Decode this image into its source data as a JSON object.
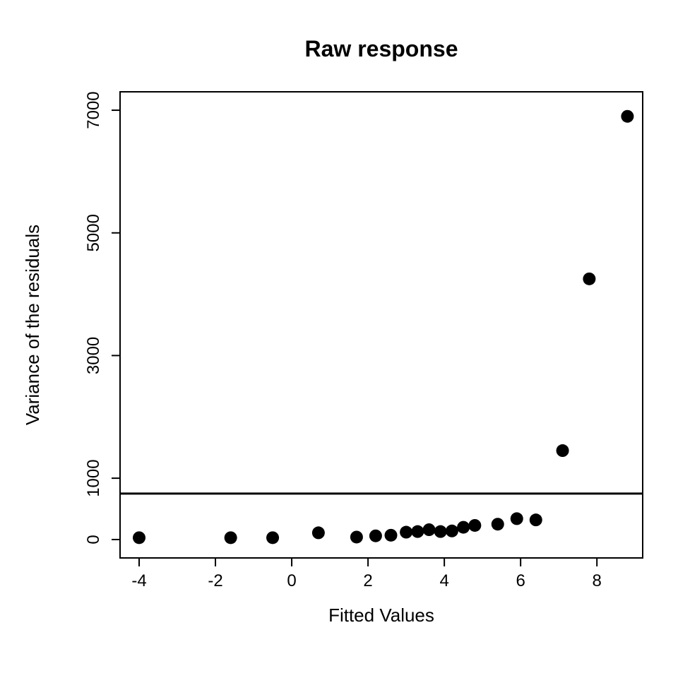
{
  "chart_data": {
    "type": "scatter",
    "title": "Raw response",
    "xlabel": "Fitted Values",
    "ylabel": "Variance of the residuals",
    "xlim": [
      -4.5,
      9.2
    ],
    "ylim": [
      -300,
      7300
    ],
    "xticks": [
      -4,
      -2,
      0,
      2,
      4,
      6,
      8
    ],
    "yticks": [
      0,
      1000,
      3000,
      5000,
      7000
    ],
    "hline": 750,
    "x": [
      -4.0,
      -1.6,
      -0.5,
      0.7,
      1.7,
      2.2,
      2.6,
      3.0,
      3.3,
      3.6,
      3.9,
      4.2,
      4.5,
      4.8,
      5.4,
      5.9,
      6.4,
      7.1,
      7.8,
      8.8
    ],
    "y": [
      30,
      30,
      30,
      110,
      40,
      60,
      70,
      120,
      130,
      160,
      130,
      140,
      200,
      230,
      250,
      340,
      320,
      1450,
      4250,
      6900
    ],
    "point_radius": 9
  }
}
